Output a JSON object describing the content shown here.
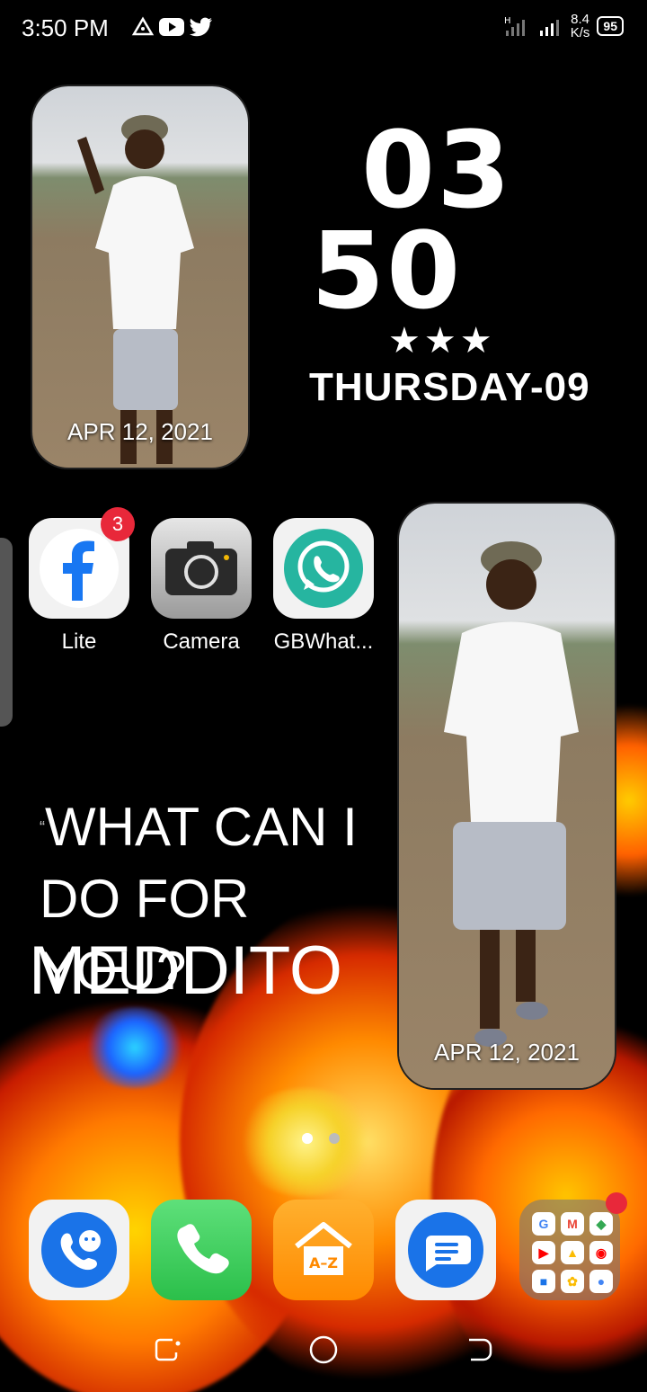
{
  "status_bar": {
    "time": "3:50 PM",
    "net_speed_value": "8.4",
    "net_speed_unit": "K/s",
    "battery": "95"
  },
  "photos": [
    {
      "date": "APR 12, 2021"
    },
    {
      "date": "APR 12, 2021"
    }
  ],
  "clock": {
    "hour": "03",
    "minute": "50",
    "stars": "★★★",
    "weekday": "THURSDAY-09"
  },
  "apps": [
    {
      "label": "Lite",
      "badge": "3"
    },
    {
      "label": "Camera"
    },
    {
      "label": "GBWhat..."
    }
  ],
  "quote": {
    "mark": "“",
    "text": "WHAT CAN I DO FOR YOU?",
    "signature": "MEDDITO"
  },
  "dock": {
    "phone_alt": "",
    "folder_icons": [
      "G",
      "M",
      "◆",
      "▶",
      "▲",
      "◉",
      "■",
      "✿",
      "●"
    ]
  },
  "colors": {
    "facebook_blue": "#1877f2",
    "whatsapp_teal": "#26b5a0",
    "phone_green": "#34c759",
    "messages_blue": "#1a73e8",
    "badge_red": "#e8283a"
  }
}
